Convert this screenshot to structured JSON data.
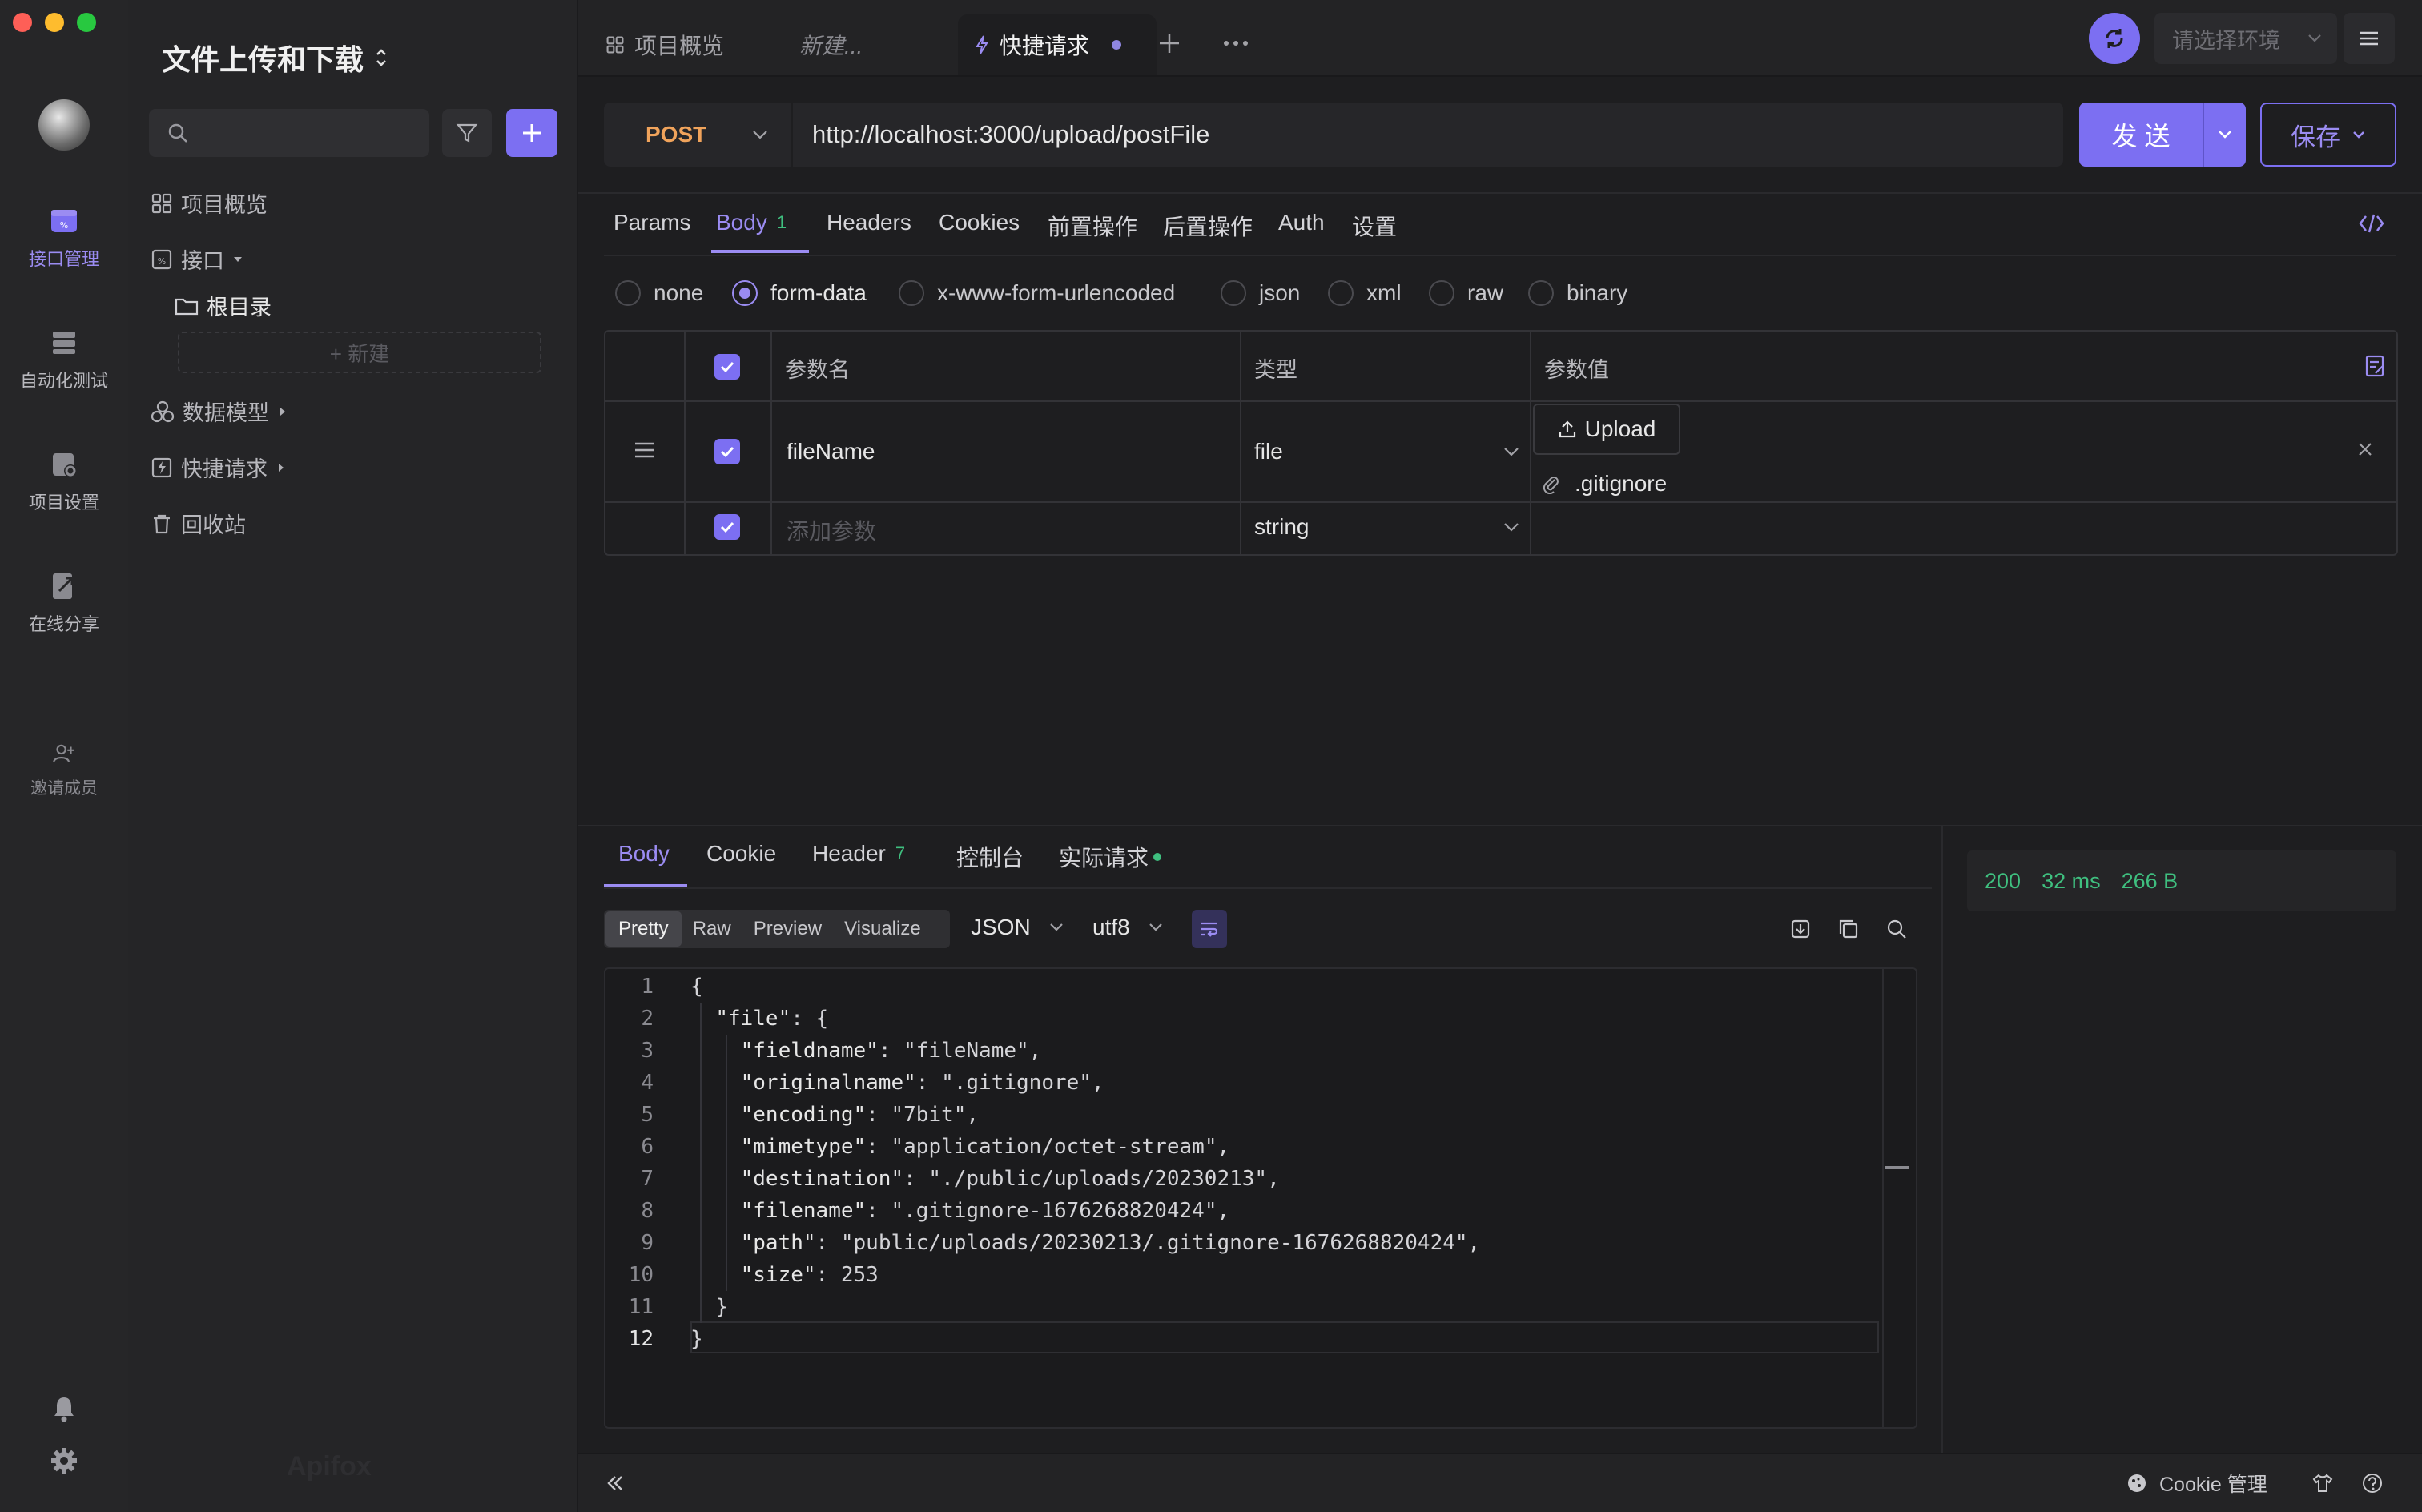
{
  "app": {
    "project_title": "文件上传和下载"
  },
  "rail": {
    "items": [
      {
        "label": "接口管理"
      },
      {
        "label": "自动化测试"
      },
      {
        "label": "项目设置"
      },
      {
        "label": "在线分享"
      },
      {
        "label": "邀请成员"
      }
    ]
  },
  "sidebar": {
    "search_placeholder": "",
    "tree": {
      "overview": "项目概览",
      "api": "接口",
      "root_dir": "根目录",
      "new": "+ 新建",
      "data_model": "数据模型",
      "quick_request": "快捷请求",
      "trash": "回收站"
    },
    "watermark": "Apifox"
  },
  "tabs": [
    {
      "label": "项目概览"
    },
    {
      "label": "新建..."
    },
    {
      "label": "快捷请求"
    }
  ],
  "env": {
    "placeholder": "请选择环境"
  },
  "request": {
    "method": "POST",
    "url": "http://localhost:3000/upload/postFile",
    "send_label": "发 送",
    "save_label": "保存"
  },
  "request_tabs": {
    "params": "Params",
    "body": "Body",
    "body_count": "1",
    "headers": "Headers",
    "cookies": "Cookies",
    "pre": "前置操作",
    "post": "后置操作",
    "auth": "Auth",
    "settings": "设置"
  },
  "body_types": [
    "none",
    "form-data",
    "x-www-form-urlencoded",
    "json",
    "xml",
    "raw",
    "binary"
  ],
  "params_table": {
    "headers": {
      "name": "参数名",
      "type": "类型",
      "value": "参数值"
    },
    "rows": [
      {
        "name": "fileName",
        "type": "file",
        "upload": "Upload",
        "file": ".gitignore"
      },
      {
        "name_placeholder": "添加参数",
        "type": "string"
      }
    ]
  },
  "response": {
    "tabs": {
      "body": "Body",
      "cookie": "Cookie",
      "header": "Header",
      "header_count": "7",
      "console": "控制台",
      "actual": "实际请求"
    },
    "format_modes": [
      "Pretty",
      "Raw",
      "Preview",
      "Visualize"
    ],
    "format": "JSON",
    "encoding": "utf8",
    "status": "200",
    "time": "32 ms",
    "size": "266 B",
    "code_lines": [
      "{",
      "  \"file\": {",
      "    \"fieldname\": \"fileName\",",
      "    \"originalname\": \".gitignore\",",
      "    \"encoding\": \"7bit\",",
      "    \"mimetype\": \"application/octet-stream\",",
      "    \"destination\": \"./public/uploads/20230213\",",
      "    \"filename\": \".gitignore-1676268820424\",",
      "    \"path\": \"public/uploads/20230213/.gitignore-1676268820424\",",
      "    \"size\": 253",
      "  }",
      "}"
    ],
    "line_numbers": [
      "1",
      "2",
      "3",
      "4",
      "5",
      "6",
      "7",
      "8",
      "9",
      "10",
      "11",
      "12"
    ]
  },
  "footer": {
    "cookie_manage": "Cookie 管理"
  },
  "colors": {
    "accent": "#7c6ff2",
    "post": "#f0a35b",
    "success": "#3fbf7f"
  }
}
